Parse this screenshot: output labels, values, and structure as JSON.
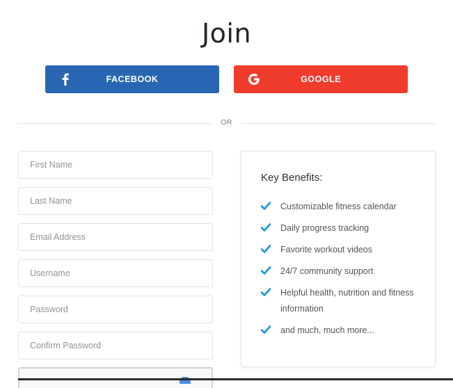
{
  "page": {
    "title": "Join"
  },
  "social": {
    "facebook_label": "FACEBOOK",
    "facebook_icon": "facebook-f-icon",
    "facebook_color": "#2866b3",
    "google_label": "GOOGLE",
    "google_icon": "google-g-icon",
    "google_color": "#f03c2d"
  },
  "divider": {
    "label": "OR"
  },
  "form": {
    "first_name_placeholder": "First Name",
    "last_name_placeholder": "Last Name",
    "email_placeholder": "Email Address",
    "username_placeholder": "Username",
    "password_placeholder": "Password",
    "confirm_password_placeholder": "Confirm Password"
  },
  "benefits": {
    "title": "Key Benefits:",
    "check_icon": "checkmark-icon",
    "check_color": "#1a9bd7",
    "items": [
      "Customizable fitness calendar",
      "Daily progress tracking",
      "Favorite workout videos",
      "24/7 community support",
      "Helpful health, nutrition and fitness information",
      "and much, much more..."
    ]
  }
}
